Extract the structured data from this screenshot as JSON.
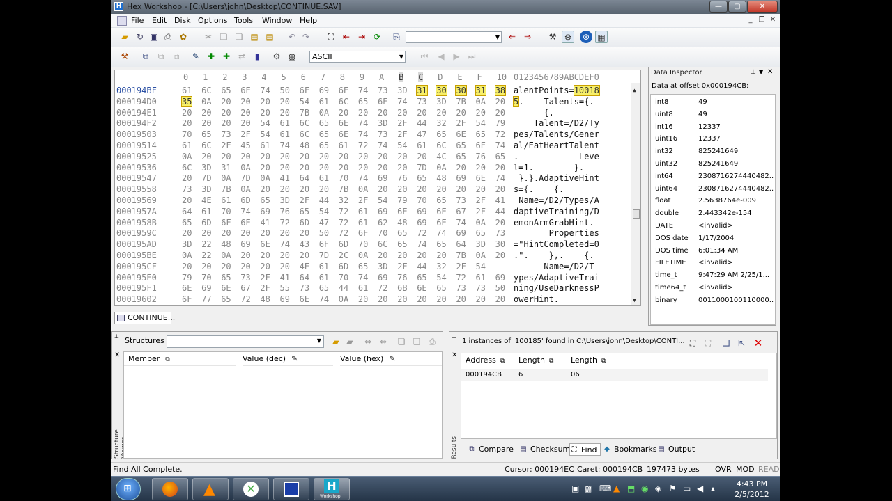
{
  "window": {
    "app_icon": "H",
    "title": "Hex Workshop - [C:\\Users\\john\\Desktop\\CONTINUE.SAV]",
    "minimize": "—",
    "maximize": "▢",
    "close": "✕"
  },
  "menu": [
    "File",
    "Edit",
    "Disk",
    "Options",
    "Tools",
    "Window",
    "Help"
  ],
  "toolbar": {
    "encoding": "ASCII"
  },
  "hex": {
    "header_cols": [
      "0",
      "1",
      "2",
      "3",
      "4",
      "5",
      "6",
      "7",
      "8",
      "9",
      "A",
      "B",
      "C",
      "D",
      "E",
      "F",
      "10"
    ],
    "header_ascii": "0123456789ABCDEF0",
    "rows": [
      {
        "addr": "000194BF",
        "bytes": [
          "61",
          "6C",
          "65",
          "6E",
          "74",
          "50",
          "6F",
          "69",
          "6E",
          "74",
          "73",
          "3D",
          "31",
          "30",
          "30",
          "31",
          "38"
        ],
        "ascii": "alentPoints=10018"
      },
      {
        "addr": "000194D0",
        "bytes": [
          "35",
          "0A",
          "20",
          "20",
          "20",
          "20",
          "54",
          "61",
          "6C",
          "65",
          "6E",
          "74",
          "73",
          "3D",
          "7B",
          "0A",
          "20"
        ],
        "ascii": "5.    Talents={."
      },
      {
        "addr": "000194E1",
        "bytes": [
          "20",
          "20",
          "20",
          "20",
          "20",
          "20",
          "7B",
          "0A",
          "20",
          "20",
          "20",
          "20",
          "20",
          "20",
          "20",
          "20",
          "20"
        ],
        "ascii": "      {."
      },
      {
        "addr": "000194F2",
        "bytes": [
          "20",
          "20",
          "20",
          "20",
          "54",
          "61",
          "6C",
          "65",
          "6E",
          "74",
          "3D",
          "2F",
          "44",
          "32",
          "2F",
          "54",
          "79"
        ],
        "ascii": "    Talent=/D2/Ty"
      },
      {
        "addr": "00019503",
        "bytes": [
          "70",
          "65",
          "73",
          "2F",
          "54",
          "61",
          "6C",
          "65",
          "6E",
          "74",
          "73",
          "2F",
          "47",
          "65",
          "6E",
          "65",
          "72"
        ],
        "ascii": "pes/Talents/Gener"
      },
      {
        "addr": "00019514",
        "bytes": [
          "61",
          "6C",
          "2F",
          "45",
          "61",
          "74",
          "48",
          "65",
          "61",
          "72",
          "74",
          "54",
          "61",
          "6C",
          "65",
          "6E",
          "74"
        ],
        "ascii": "al/EatHeartTalent"
      },
      {
        "addr": "00019525",
        "bytes": [
          "0A",
          "20",
          "20",
          "20",
          "20",
          "20",
          "20",
          "20",
          "20",
          "20",
          "20",
          "20",
          "20",
          "4C",
          "65",
          "76",
          "65"
        ],
        "ascii": ".            Leve"
      },
      {
        "addr": "00019536",
        "bytes": [
          "6C",
          "3D",
          "31",
          "0A",
          "20",
          "20",
          "20",
          "20",
          "20",
          "20",
          "20",
          "20",
          "7D",
          "0A",
          "20",
          "20",
          "20"
        ],
        "ascii": "l=1.        }."
      },
      {
        "addr": "00019547",
        "bytes": [
          "20",
          "7D",
          "0A",
          "7D",
          "0A",
          "41",
          "64",
          "61",
          "70",
          "74",
          "69",
          "76",
          "65",
          "48",
          "69",
          "6E",
          "74"
        ],
        "ascii": " }.}.AdaptiveHint"
      },
      {
        "addr": "00019558",
        "bytes": [
          "73",
          "3D",
          "7B",
          "0A",
          "20",
          "20",
          "20",
          "20",
          "7B",
          "0A",
          "20",
          "20",
          "20",
          "20",
          "20",
          "20",
          "20"
        ],
        "ascii": "s={.    {."
      },
      {
        "addr": "00019569",
        "bytes": [
          "20",
          "4E",
          "61",
          "6D",
          "65",
          "3D",
          "2F",
          "44",
          "32",
          "2F",
          "54",
          "79",
          "70",
          "65",
          "73",
          "2F",
          "41"
        ],
        "ascii": " Name=/D2/Types/A"
      },
      {
        "addr": "0001957A",
        "bytes": [
          "64",
          "61",
          "70",
          "74",
          "69",
          "76",
          "65",
          "54",
          "72",
          "61",
          "69",
          "6E",
          "69",
          "6E",
          "67",
          "2F",
          "44"
        ],
        "ascii": "daptiveTraining/D"
      },
      {
        "addr": "0001958B",
        "bytes": [
          "65",
          "6D",
          "6F",
          "6E",
          "41",
          "72",
          "6D",
          "47",
          "72",
          "61",
          "62",
          "48",
          "69",
          "6E",
          "74",
          "0A",
          "20"
        ],
        "ascii": "emonArmGrabHint."
      },
      {
        "addr": "0001959C",
        "bytes": [
          "20",
          "20",
          "20",
          "20",
          "20",
          "20",
          "20",
          "50",
          "72",
          "6F",
          "70",
          "65",
          "72",
          "74",
          "69",
          "65",
          "73"
        ],
        "ascii": "       Properties"
      },
      {
        "addr": "000195AD",
        "bytes": [
          "3D",
          "22",
          "48",
          "69",
          "6E",
          "74",
          "43",
          "6F",
          "6D",
          "70",
          "6C",
          "65",
          "74",
          "65",
          "64",
          "3D",
          "30"
        ],
        "ascii": "=\"HintCompleted=0"
      },
      {
        "addr": "000195BE",
        "bytes": [
          "0A",
          "22",
          "0A",
          "20",
          "20",
          "20",
          "20",
          "7D",
          "2C",
          "0A",
          "20",
          "20",
          "20",
          "20",
          "7B",
          "0A",
          "20"
        ],
        "ascii": ".\".    },.    {."
      },
      {
        "addr": "000195CF",
        "bytes": [
          "20",
          "20",
          "20",
          "20",
          "20",
          "20",
          "4E",
          "61",
          "6D",
          "65",
          "3D",
          "2F",
          "44",
          "32",
          "2F",
          "54"
        ],
        "ascii": "      Name=/D2/T"
      },
      {
        "addr": "000195E0",
        "bytes": [
          "79",
          "70",
          "65",
          "73",
          "2F",
          "41",
          "64",
          "61",
          "70",
          "74",
          "69",
          "76",
          "65",
          "54",
          "72",
          "61",
          "69"
        ],
        "ascii": "ypes/AdaptiveTrai"
      },
      {
        "addr": "000195F1",
        "bytes": [
          "6E",
          "69",
          "6E",
          "67",
          "2F",
          "55",
          "73",
          "65",
          "44",
          "61",
          "72",
          "6B",
          "6E",
          "65",
          "73",
          "73",
          "50"
        ],
        "ascii": "ning/UseDarknessP"
      },
      {
        "addr": "00019602",
        "bytes": [
          "6F",
          "77",
          "65",
          "72",
          "48",
          "69",
          "6E",
          "74",
          "0A",
          "20",
          "20",
          "20",
          "20",
          "20",
          "20",
          "20",
          "20"
        ],
        "ascii": "owerHint."
      }
    ],
    "selection": {
      "ascii_row0": "10018",
      "ascii_row1": "5"
    }
  },
  "doc_tab": "CONTINUE...",
  "inspector": {
    "title": "Data Inspector",
    "offset_label": "Data at offset 0x000194CB:",
    "items": [
      {
        "name": "int8",
        "value": "49"
      },
      {
        "name": "uint8",
        "value": "49"
      },
      {
        "name": "int16",
        "value": "12337"
      },
      {
        "name": "uint16",
        "value": "12337"
      },
      {
        "name": "int32",
        "value": "825241649"
      },
      {
        "name": "uint32",
        "value": "825241649"
      },
      {
        "name": "int64",
        "value": "2308716274440482..."
      },
      {
        "name": "uint64",
        "value": "2308716274440482..."
      },
      {
        "name": "float",
        "value": "2.5638764e-009"
      },
      {
        "name": "double",
        "value": "2.443342e-154"
      },
      {
        "name": "DATE",
        "value": "<invalid>"
      },
      {
        "name": "DOS date",
        "value": "1/17/2004"
      },
      {
        "name": "DOS time",
        "value": "6:01:34 AM"
      },
      {
        "name": "FILETIME",
        "value": "<invalid>"
      },
      {
        "name": "time_t",
        "value": "9:47:29 AM 2/25/1..."
      },
      {
        "name": "time64_t",
        "value": "<invalid>"
      },
      {
        "name": "binary",
        "value": "0011000100110000..."
      }
    ]
  },
  "structures": {
    "side_label": "Structure Viewer",
    "label": "Structures",
    "col_member": "Member",
    "col_dec": "Value (dec)",
    "col_hex": "Value (hex)"
  },
  "find": {
    "side_label": "Results",
    "message": "1 instances of '100185' found in C:\\Users\\john\\Desktop\\CONTI...",
    "col_address": "Address",
    "col_length1": "Length",
    "col_length2": "Length",
    "results": [
      {
        "address": "000194CB",
        "length": "6",
        "length2": "06"
      }
    ],
    "tabs": [
      "Compare",
      "Checksum",
      "Find",
      "Bookmarks",
      "Output"
    ]
  },
  "status": {
    "left": "Find All Complete.",
    "cursor": "Cursor: 000194EC",
    "caret": "Caret: 000194CB",
    "size": "197473 bytes",
    "ovr": "OVR",
    "mod": "MOD",
    "read": "READ"
  },
  "taskbar": {
    "time": "4:43 PM",
    "date": "2/5/2012",
    "hw_label": "Workshop"
  },
  "colors": {
    "selection": "#f7ef69",
    "address": "#2a4fa3",
    "title_bg": "#6b7682"
  }
}
